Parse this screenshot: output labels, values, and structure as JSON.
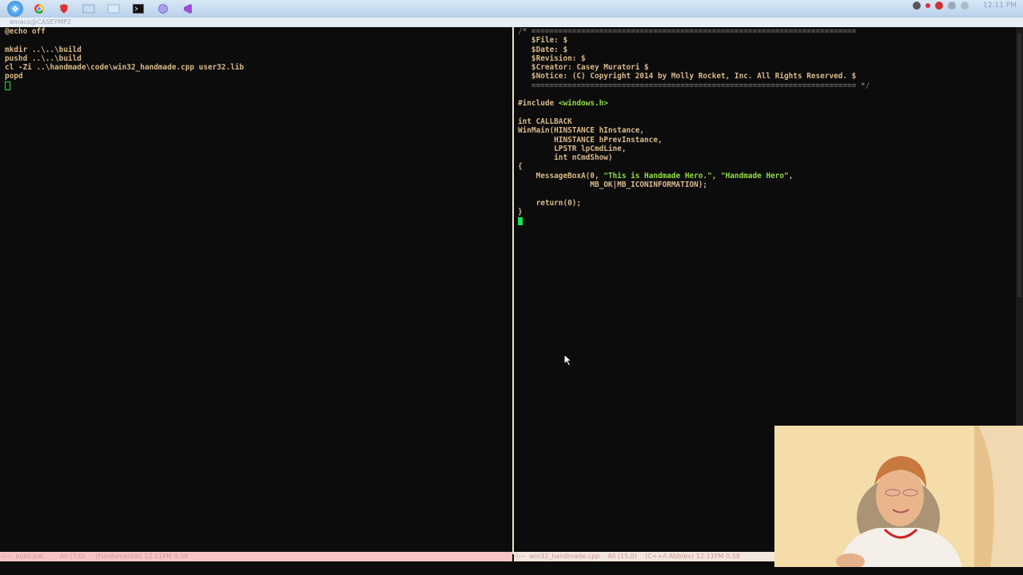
{
  "taskbar": {
    "buttons": [
      "start-orb",
      "chrome",
      "antivirus",
      "explorer-1",
      "explorer-2",
      "console",
      "app",
      "visual-studio"
    ],
    "clock": "12:11 PM"
  },
  "emacs": {
    "title": "emacs@CASEYMP2"
  },
  "left_buffer": {
    "lines": [
      "@echo off",
      "",
      "mkdir ..\\..\\build",
      "pushd ..\\..\\build",
      "cl -Zi ..\\handmade\\code\\win32_handmade.cpp user32.lib",
      "popd"
    ],
    "modeline": "-\\---  build.bat        All (7,0)     (Fundamental) 12:11PM 0.59"
  },
  "right_buffer": {
    "header_rule_top": "/* ========================================================================",
    "header": [
      "   $File: $",
      "   $Date: $",
      "   $Revision: $",
      "   $Creator: Casey Muratori $",
      "   $Notice: (C) Copyright 2014 by Molly Rocket, Inc. All Rights Reserved. $"
    ],
    "header_rule_bottom": "   ======================================================================== */",
    "include_directive": "#include ",
    "include_file": "<windows.h>",
    "code": {
      "l1": "int CALLBACK",
      "l2": "WinMain(HINSTANCE hInstance,",
      "l3": "        HINSTANCE hPrevInstance,",
      "l4": "        LPSTR lpCmdLine,",
      "l5": "        int nCmdShow)",
      "l6": "{",
      "l7a": "    MessageBoxA(0, ",
      "l7s1": "\"This is Handmade Hero.\"",
      "l7b": ", ",
      "l7s2": "\"Handmade Hero\"",
      "l7c": ",",
      "l8": "                MB_OK|MB_ICONINFORMATION);",
      "l9": "",
      "l10": "    return(0);",
      "l11": "}"
    },
    "modeline": "-\\---  win32_handmade.cpp    All (15,0)    (C++/l Abbrev) 12:11PM 0.59"
  },
  "colors": {
    "background": "#0c0c0c",
    "text": "#d9b98a",
    "string": "#8fdc45",
    "cursor": "#19e34a",
    "left_modeline": "#f7c4c4",
    "right_modeline": "#f3e6dc"
  },
  "webcam": {
    "description_icon": "presenter-video"
  }
}
